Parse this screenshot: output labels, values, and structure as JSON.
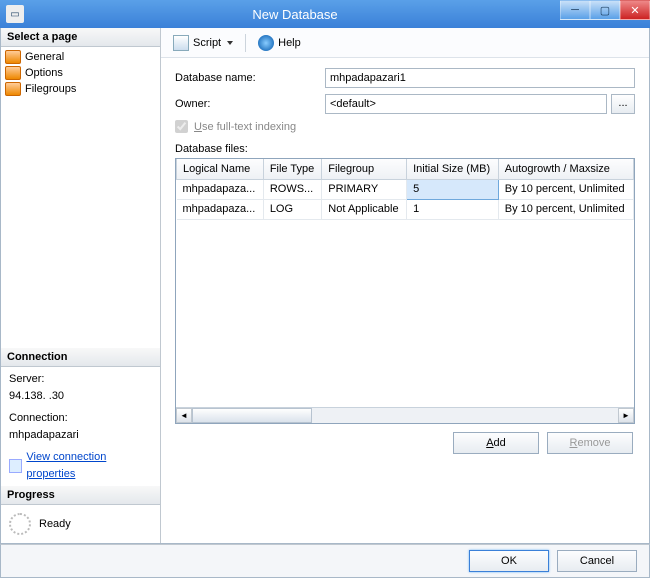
{
  "window": {
    "title": "New Database"
  },
  "sidebar": {
    "select_header": "Select a page",
    "pages": [
      {
        "label": "General"
      },
      {
        "label": "Options"
      },
      {
        "label": "Filegroups"
      }
    ],
    "connection_header": "Connection",
    "server_label": "Server:",
    "server_value": "94.138.      .30",
    "connection_label": "Connection:",
    "connection_value": "mhpadapazari",
    "view_props": "View connection properties",
    "progress_header": "Progress",
    "progress_value": "Ready"
  },
  "toolbar": {
    "script": "Script",
    "help": "Help"
  },
  "form": {
    "dbname_label": "Database name:",
    "dbname_value": "mhpadapazari1",
    "owner_label": "Owner:",
    "owner_value": "<default>",
    "fulltext_label": "Use full-text indexing",
    "files_label": "Database files:",
    "columns": {
      "logical": "Logical Name",
      "filetype": "File Type",
      "filegroup": "Filegroup",
      "initsize": "Initial Size (MB)",
      "autogrow": "Autogrowth / Maxsize"
    },
    "rows": [
      {
        "logical": "mhpadapaza...",
        "filetype": "ROWS...",
        "filegroup": "PRIMARY",
        "initsize": "5",
        "autogrow": "By 10 percent, Unlimited"
      },
      {
        "logical": "mhpadapaza...",
        "filetype": "LOG",
        "filegroup": "Not Applicable",
        "initsize": "1",
        "autogrow": "By 10 percent, Unlimited"
      }
    ],
    "add": "Add",
    "remove": "Remove"
  },
  "footer": {
    "ok": "OK",
    "cancel": "Cancel"
  }
}
